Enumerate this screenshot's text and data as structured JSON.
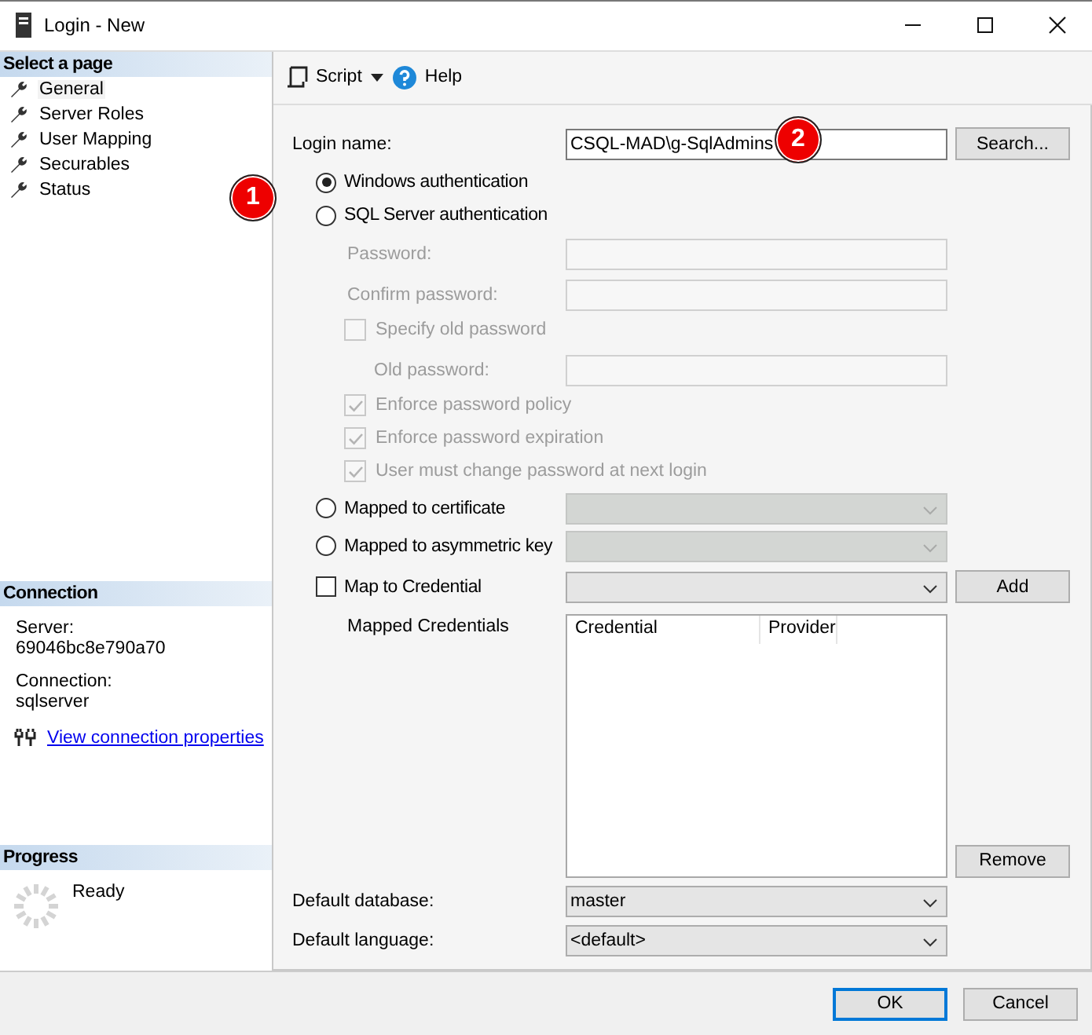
{
  "window": {
    "title": "Login - New"
  },
  "sidebar": {
    "header": "Select a page",
    "pages": [
      {
        "label": "General",
        "selected": true
      },
      {
        "label": "Server Roles",
        "selected": false
      },
      {
        "label": "User Mapping",
        "selected": false
      },
      {
        "label": "Securables",
        "selected": false
      },
      {
        "label": "Status",
        "selected": false
      }
    ],
    "connection": {
      "header": "Connection",
      "server_label": "Server:",
      "server": "69046bc8e790a70",
      "connection_label": "Connection:",
      "connection": "sqlserver",
      "link": "View connection properties"
    },
    "progress": {
      "header": "Progress",
      "status": "Ready"
    }
  },
  "toolbar": {
    "script": "Script",
    "help": "Help"
  },
  "form": {
    "login_name": {
      "label": "Login name:",
      "value": "CSQL-MAD\\g-SqlAdmins",
      "button": "Search..."
    },
    "auth_options": [
      {
        "label": "Windows authentication",
        "selected": true
      },
      {
        "label": "SQL Server authentication",
        "selected": false
      }
    ],
    "sql_section": {
      "disabled": true,
      "items": [
        {
          "kind": "field",
          "label": "Password:"
        },
        {
          "kind": "field",
          "label": "Confirm password:"
        },
        {
          "kind": "checkbox",
          "label": "Specify old password",
          "checked": false
        },
        {
          "kind": "oldfield",
          "label": "Old password:"
        },
        {
          "kind": "checkbox",
          "label": "Enforce password policy",
          "checked": true
        },
        {
          "kind": "checkbox",
          "label": "Enforce password expiration",
          "checked": true
        },
        {
          "kind": "checkbox",
          "label": "User must change password at next login",
          "checked": true
        }
      ]
    },
    "mapped_options": [
      {
        "label": "Mapped to certificate",
        "selected": false,
        "disabled": true
      },
      {
        "label": "Mapped to asymmetric key",
        "selected": false,
        "disabled": true
      }
    ],
    "map_credential": {
      "label": "Map to Credential",
      "checked": false,
      "button": "Add"
    },
    "mapped_credentials": {
      "label": "Mapped Credentials",
      "columns": [
        "Credential",
        "Provider"
      ],
      "button": "Remove"
    },
    "default_database": {
      "label": "Default database:",
      "value": "master"
    },
    "default_language": {
      "label": "Default language:",
      "value": "<default>"
    }
  },
  "buttons": [
    {
      "label": "OK",
      "default": true
    },
    {
      "label": "Cancel",
      "default": false
    }
  ],
  "callouts": [
    {
      "label": "1"
    },
    {
      "label": "2"
    }
  ]
}
